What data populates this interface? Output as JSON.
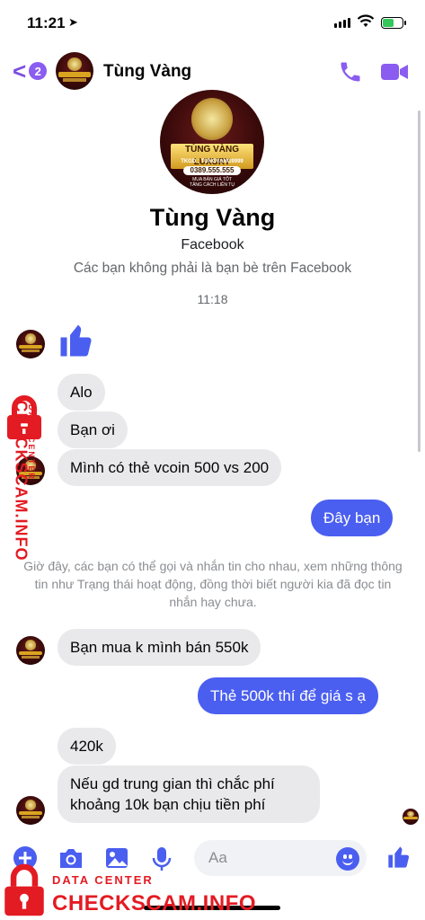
{
  "status_bar": {
    "time": "11:21",
    "location_arrow": "location-arrow-icon",
    "battery_charging": true
  },
  "header": {
    "back_badge": "2",
    "contact_name": "Tùng Vàng",
    "accent_color": "#8a5cf0"
  },
  "profile": {
    "name": "Tùng Vàng",
    "source": "Facebook",
    "note": "Các bạn không phải là bạn bè trên Facebook",
    "avatar_logo": {
      "title": "TÙNG VÀNG LUXURY",
      "tkgd": "TKGD : TUNGVANG9999",
      "phone": "0389.555.555",
      "sub_line1": "MUA BÁN GIÁ TỐT",
      "sub_line2": "TĂNG CÁCH LIÊN TỤ"
    }
  },
  "conversation": {
    "timestamp": "11:18",
    "incoming_1": [
      "Alo",
      "Bạn ơi",
      "Mình có thẻ vcoin 500 vs 200"
    ],
    "outgoing_1": "Đây bạn",
    "system_note": "Giờ đây, các bạn có thể gọi và nhắn tin cho nhau, xem những thông tin như Trạng thái hoạt động, đồng thời biết người kia đã đọc tin nhắn hay chưa.",
    "incoming_2": "Bạn mua k mình bán 550k",
    "outgoing_2": "Thẻ 500k thí để giá s ạ",
    "incoming_3": [
      "420k",
      "Nếu gd trung gian thì chắc phí khoảng 10k bạn chịu tiền phí"
    ]
  },
  "composer": {
    "placeholder": "Aa",
    "icons": [
      "plus-icon",
      "camera-icon",
      "image-icon",
      "microphone-icon",
      "emoji-icon",
      "thumbs-up-icon"
    ]
  },
  "watermark": {
    "label": "DATA CENTER",
    "brand": "CHECKSCAM.INFO",
    "color": "#e31b23"
  },
  "colors": {
    "outgoing_bubble": "#4a5ef0",
    "incoming_bubble": "#e9e9eb",
    "like": "#4a5ef0"
  }
}
